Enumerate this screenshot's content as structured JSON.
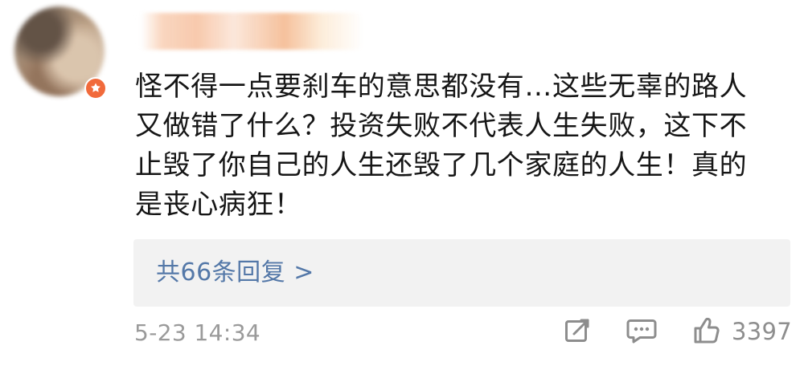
{
  "comment": {
    "lines": [
      "怪不得一点要刹车的意思都没有…这些无辜的路人",
      "又做错了什么？投资失败不代表人生失败，这下不",
      "止毁了你自己的人生还毁了几个家庭的人生！真的",
      "是丧心病狂！"
    ]
  },
  "replies": {
    "link_text": "共66条回复 >"
  },
  "footer": {
    "timestamp": "5-23 14:34",
    "like_count": "3397"
  },
  "icons": {
    "badge": "star-badge-icon",
    "share": "edit-share-icon",
    "comment": "comment-icon",
    "like": "thumbs-up-icon"
  },
  "colors": {
    "link": "#5478a8",
    "meta": "#9a9a9a",
    "badge": "#f16a3b",
    "reply_bg": "#f2f2f2"
  }
}
